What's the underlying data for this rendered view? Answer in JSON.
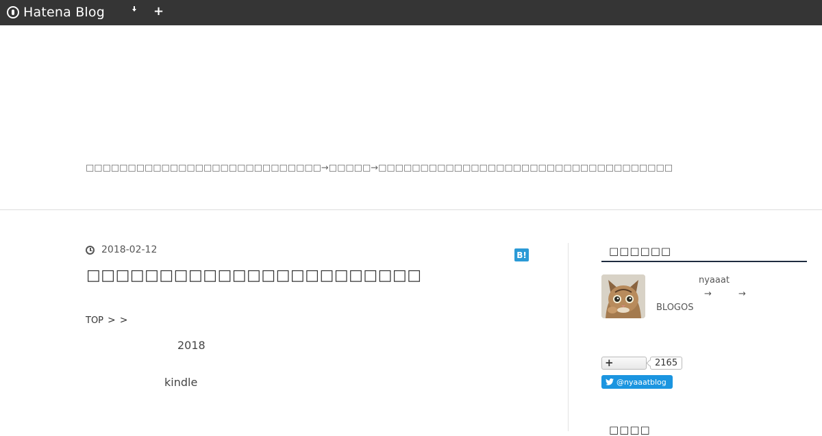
{
  "topbar": {
    "logo_text": "Hatena Blog",
    "logo_icon": "hatena-logo-icon",
    "menu_icon": "caret-down-icon",
    "add_icon": "plus-icon"
  },
  "header": {
    "tagline": "□□□□□□□□□□□□□□□□□□□□□□□□□□□□→□□□□□→□□□□□□□□□□□□□□□□□□□□□□□□□□□□□□□□□□□"
  },
  "article": {
    "date": "2018-02-12",
    "bookmark_label": "B!",
    "title": "□□□□□□□□□□□□□□□□□□□□□□□",
    "breadcrumb": {
      "top": "TOP",
      "sep1": ">",
      "sep2": ">"
    },
    "body": {
      "line1": "2018",
      "line2": "kindle"
    }
  },
  "sidebar": {
    "profile_title": "□□□□□□",
    "profile_name": "nyaaat",
    "arrow1": "→",
    "arrow2": "→",
    "profile_site": "BLOGOS",
    "follow_icon": "plus-icon",
    "follow_count": "2165",
    "twitter_label": "@nyaaatblog",
    "next_title": "□□□□"
  },
  "colors": {
    "topbar": "#353535",
    "twitter": "#1b95e0",
    "bookmark": "#2b9ad6",
    "side_rule": "#1e2b3f"
  }
}
